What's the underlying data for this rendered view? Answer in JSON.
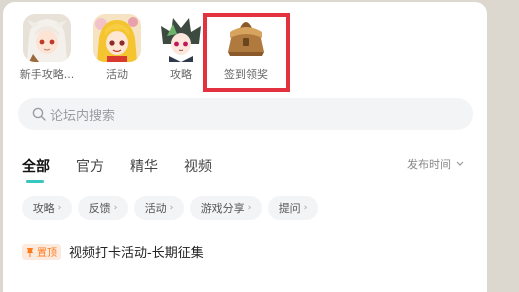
{
  "shortcuts": [
    {
      "label": "新手攻略...",
      "icon": "white-hair-character-avatar"
    },
    {
      "label": "活动",
      "icon": "blonde-girl-character-avatar"
    },
    {
      "label": "攻略",
      "icon": "green-hair-character-avatar"
    },
    {
      "label": "签到领奖",
      "icon": "treasure-chest-icon"
    }
  ],
  "search": {
    "placeholder": "论坛内搜索",
    "icon": "search-icon"
  },
  "tabs": [
    "全部",
    "官方",
    "精华",
    "视频"
  ],
  "active_tab": "全部",
  "sort": {
    "label": "发布时间",
    "icon": "chevron-down-icon"
  },
  "categories": [
    "攻略",
    "反馈",
    "活动",
    "游戏分享",
    "提问"
  ],
  "pinned_post": {
    "badge": "置顶",
    "title": "视频打卡活动-长期征集"
  },
  "colors": {
    "accent": "#38c6c0",
    "highlight_border": "#e2323f",
    "badge_text": "#ff7a1a",
    "badge_bg": "#fdeadf"
  }
}
